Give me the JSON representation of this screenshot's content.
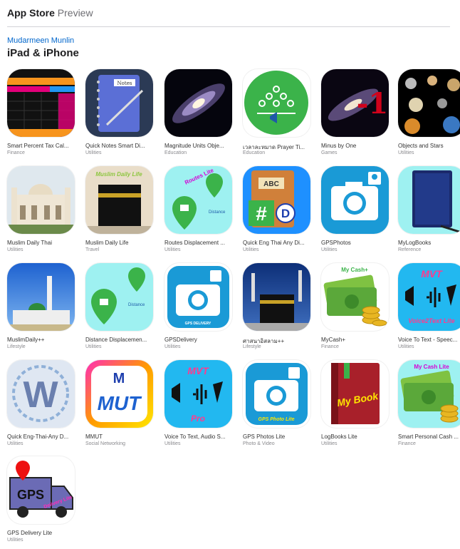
{
  "header": {
    "brand_bold": "App Store",
    "brand_light": "Preview"
  },
  "developer": "Mudarmeen Munlin",
  "section_title": "iPad & iPhone",
  "colors": {
    "link": "#0066cc",
    "divider": "#d2d2d7"
  },
  "apps": [
    {
      "name": "Smart Percent Tax Cal...",
      "category": "Finance",
      "icon": "tax-calculator-icon"
    },
    {
      "name": "Quick Notes Smart Di...",
      "category": "Utilities",
      "icon": "notebook-icon"
    },
    {
      "name": "Magnitude Units Obje...",
      "category": "Education",
      "icon": "galaxy-icon"
    },
    {
      "name": "เวลาละหมาด Prayer Ti...",
      "category": "Education",
      "icon": "prayer-group-icon"
    },
    {
      "name": "Minus by One",
      "category": "Games",
      "icon": "minus-one-galaxy-icon"
    },
    {
      "name": "Objects and Stars",
      "category": "Utilities",
      "icon": "planets-icon"
    },
    {
      "name": "Muslim Daily Thai",
      "category": "Utilities",
      "icon": "mosque-icon"
    },
    {
      "name": "Muslim Daily Life",
      "category": "Travel",
      "icon": "kaaba-icon"
    },
    {
      "name": "Routes Displacement ...",
      "category": "Utilities",
      "icon": "routes-map-icon"
    },
    {
      "name": "Quick Eng Thai Any Di...",
      "category": "Utilities",
      "icon": "dictionary-book-icon"
    },
    {
      "name": "GPSPhotos",
      "category": "Utilities",
      "icon": "camera-icon"
    },
    {
      "name": "MyLogBooks",
      "category": "Reference",
      "icon": "logbook-icon"
    },
    {
      "name": "MuslimDaily++",
      "category": "Lifestyle",
      "icon": "mosque-minaret-icon"
    },
    {
      "name": "Distance Displacemen...",
      "category": "Utilities",
      "icon": "distance-map-icon"
    },
    {
      "name": "GPSDelivery",
      "category": "Utilities",
      "icon": "camera-delivery-icon"
    },
    {
      "name": "ศาสนาอิสลาม++",
      "category": "Lifestyle",
      "icon": "kaaba-night-icon"
    },
    {
      "name": "MyCash+",
      "category": "Finance",
      "icon": "cash-coins-icon"
    },
    {
      "name": "Voice To Text - Speec...",
      "category": "Utilities",
      "icon": "voice-to-text-icon"
    },
    {
      "name": "Quick Eng-Thai-Any D...",
      "category": "Utilities",
      "icon": "letter-w-icon"
    },
    {
      "name": "MMUT",
      "category": "Social Networking",
      "icon": "mmut-logo-icon"
    },
    {
      "name": "Voice To Text, Audio S...",
      "category": "Utilities",
      "icon": "voice-pro-icon"
    },
    {
      "name": "GPS Photos Lite",
      "category": "Photo & Video",
      "icon": "camera-lite-icon"
    },
    {
      "name": "LogBooks Lite",
      "category": "Utilities",
      "icon": "my-book-icon"
    },
    {
      "name": "Smart Personal Cash ...",
      "category": "Finance",
      "icon": "cash-lite-icon"
    },
    {
      "name": "GPS Delivery Lite",
      "category": "Utilities",
      "icon": "delivery-truck-icon"
    }
  ],
  "icon_text": {
    "notes": "Notes",
    "muslim_daily_life": "Muslim Daily Life",
    "routes_lite": "Routes Lite",
    "distance": "Distance",
    "abc": "ABC",
    "hash": "#",
    "d": "D",
    "gps_delivery": "GPS DELIVERY",
    "my_cash": "My Cash+",
    "voice_mvt": "MVT",
    "voice_lite": "Voice2Text Lite",
    "w": "W",
    "m": "M",
    "mut": "MUT",
    "pro": "Pro",
    "gps_photo_lite": "GPS Photo Lite",
    "my_book": "My Book",
    "my_cash_lite": "My Cash Lite",
    "gps": "GPS",
    "delivery_lite": "Delivery Lite",
    "minus_one": "-1"
  }
}
